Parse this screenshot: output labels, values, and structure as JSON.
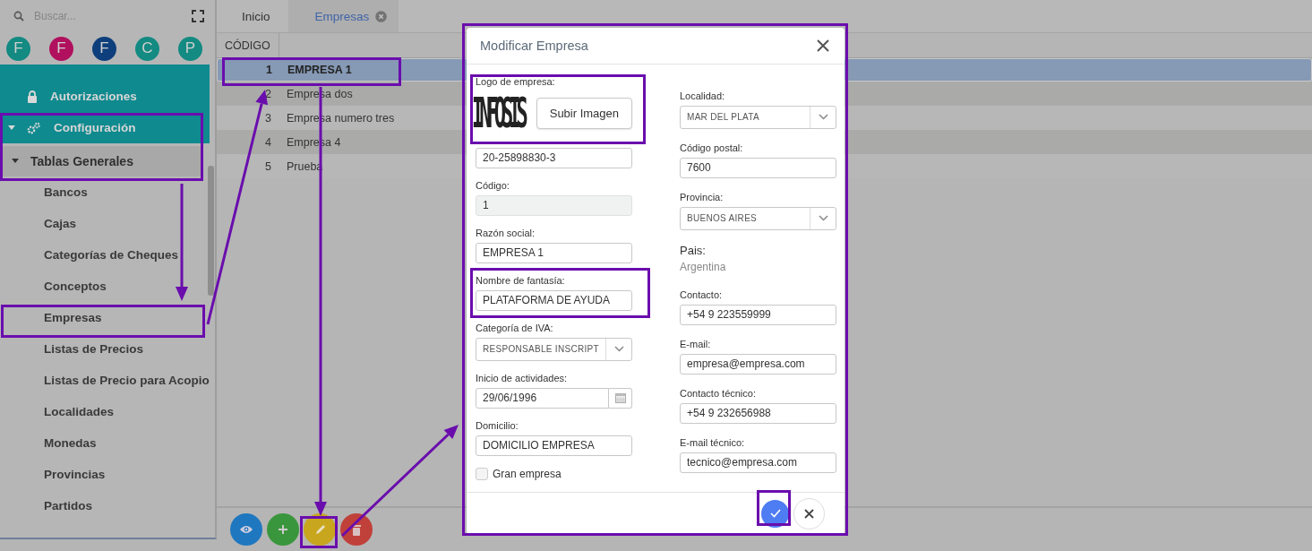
{
  "sidebar": {
    "search": {
      "placeholder": "Buscar..."
    },
    "shortcuts": [
      {
        "letter": "F",
        "color": "#138a82"
      },
      {
        "letter": "F",
        "color": "#b0105e"
      },
      {
        "letter": "F",
        "color": "#0e3f7c"
      },
      {
        "letter": "C",
        "color": "#138a82"
      },
      {
        "letter": "P",
        "color": "#138a82"
      }
    ],
    "modules": [
      {
        "label": "Autorizaciones"
      },
      {
        "label": "Configuración",
        "expanded": true,
        "children": [
          {
            "label": "Tablas Generales",
            "expanded": true,
            "children": [
              {
                "label": "Bancos"
              },
              {
                "label": "Cajas"
              },
              {
                "label": "Categorías de Cheques"
              },
              {
                "label": "Conceptos"
              },
              {
                "label": "Empresas"
              },
              {
                "label": "Listas de Precios"
              },
              {
                "label": "Listas de Precio para Acopio"
              },
              {
                "label": "Localidades"
              },
              {
                "label": "Monedas"
              },
              {
                "label": "Provincias"
              },
              {
                "label": "Partidos"
              }
            ]
          }
        ]
      }
    ]
  },
  "tabs": [
    {
      "label": "Inicio",
      "selected": false
    },
    {
      "label": "Empresas",
      "selected": true
    }
  ],
  "table": {
    "columns": [
      "CÓDIGO"
    ],
    "rows": [
      {
        "code": "1",
        "name": "EMPRESA 1",
        "selected": true
      },
      {
        "code": "2",
        "name": "Empresa dos",
        "selected": false
      },
      {
        "code": "3",
        "name": "Empresa numero tres",
        "selected": false
      },
      {
        "code": "4",
        "name": "Empresa 4",
        "selected": false
      },
      {
        "code": "5",
        "name": "Prueba",
        "selected": false
      }
    ]
  },
  "toolbar": {
    "buttons": [
      {
        "kind": "view"
      },
      {
        "kind": "add"
      },
      {
        "kind": "edit"
      },
      {
        "kind": "delete"
      }
    ]
  },
  "dialog": {
    "title": "Modificar Empresa",
    "left": [
      {
        "kind": "logo",
        "label": "Logo de empresa:",
        "logo": "INFOSIS",
        "button": "Subir Imagen"
      },
      {
        "kind": "input",
        "value": "20-25898830-3"
      },
      {
        "kind": "readonly",
        "label": "Código:",
        "value": "1"
      },
      {
        "kind": "input",
        "label": "Razón social:",
        "value": "EMPRESA 1"
      },
      {
        "kind": "input",
        "label": "Nombre de fantasía:",
        "value": "PLATAFORMA DE AYUDA"
      },
      {
        "kind": "select",
        "label": "Categoría de IVA:",
        "value": "RESPONSABLE INSCRIPT"
      },
      {
        "kind": "date",
        "label": "Inicio de actividades:",
        "value": "29/06/1996"
      },
      {
        "kind": "input",
        "label": "Domicilio:",
        "value": "DOMICILIO EMPRESA"
      },
      {
        "kind": "checkbox",
        "label": "Gran empresa",
        "checked": false
      }
    ],
    "right": [
      {
        "kind": "select",
        "label": "Localidad:",
        "value": "MAR DEL PLATA"
      },
      {
        "kind": "input",
        "label": "Código postal:",
        "value": "7600"
      },
      {
        "kind": "select",
        "label": "Provincia:",
        "value": "BUENOS AIRES"
      },
      {
        "kind": "static",
        "label": "Pais:",
        "value": "Argentina"
      },
      {
        "kind": "input",
        "label": "Contacto:",
        "value": "+54 9 223559999"
      },
      {
        "kind": "input",
        "label": "E-mail:",
        "value": "empresa@empresa.com"
      },
      {
        "kind": "input",
        "label": "Contacto técnico:",
        "value": "+54 9 232656988"
      },
      {
        "kind": "input",
        "label": "E-mail técnico:",
        "value": "tecnico@empresa.com"
      }
    ]
  }
}
